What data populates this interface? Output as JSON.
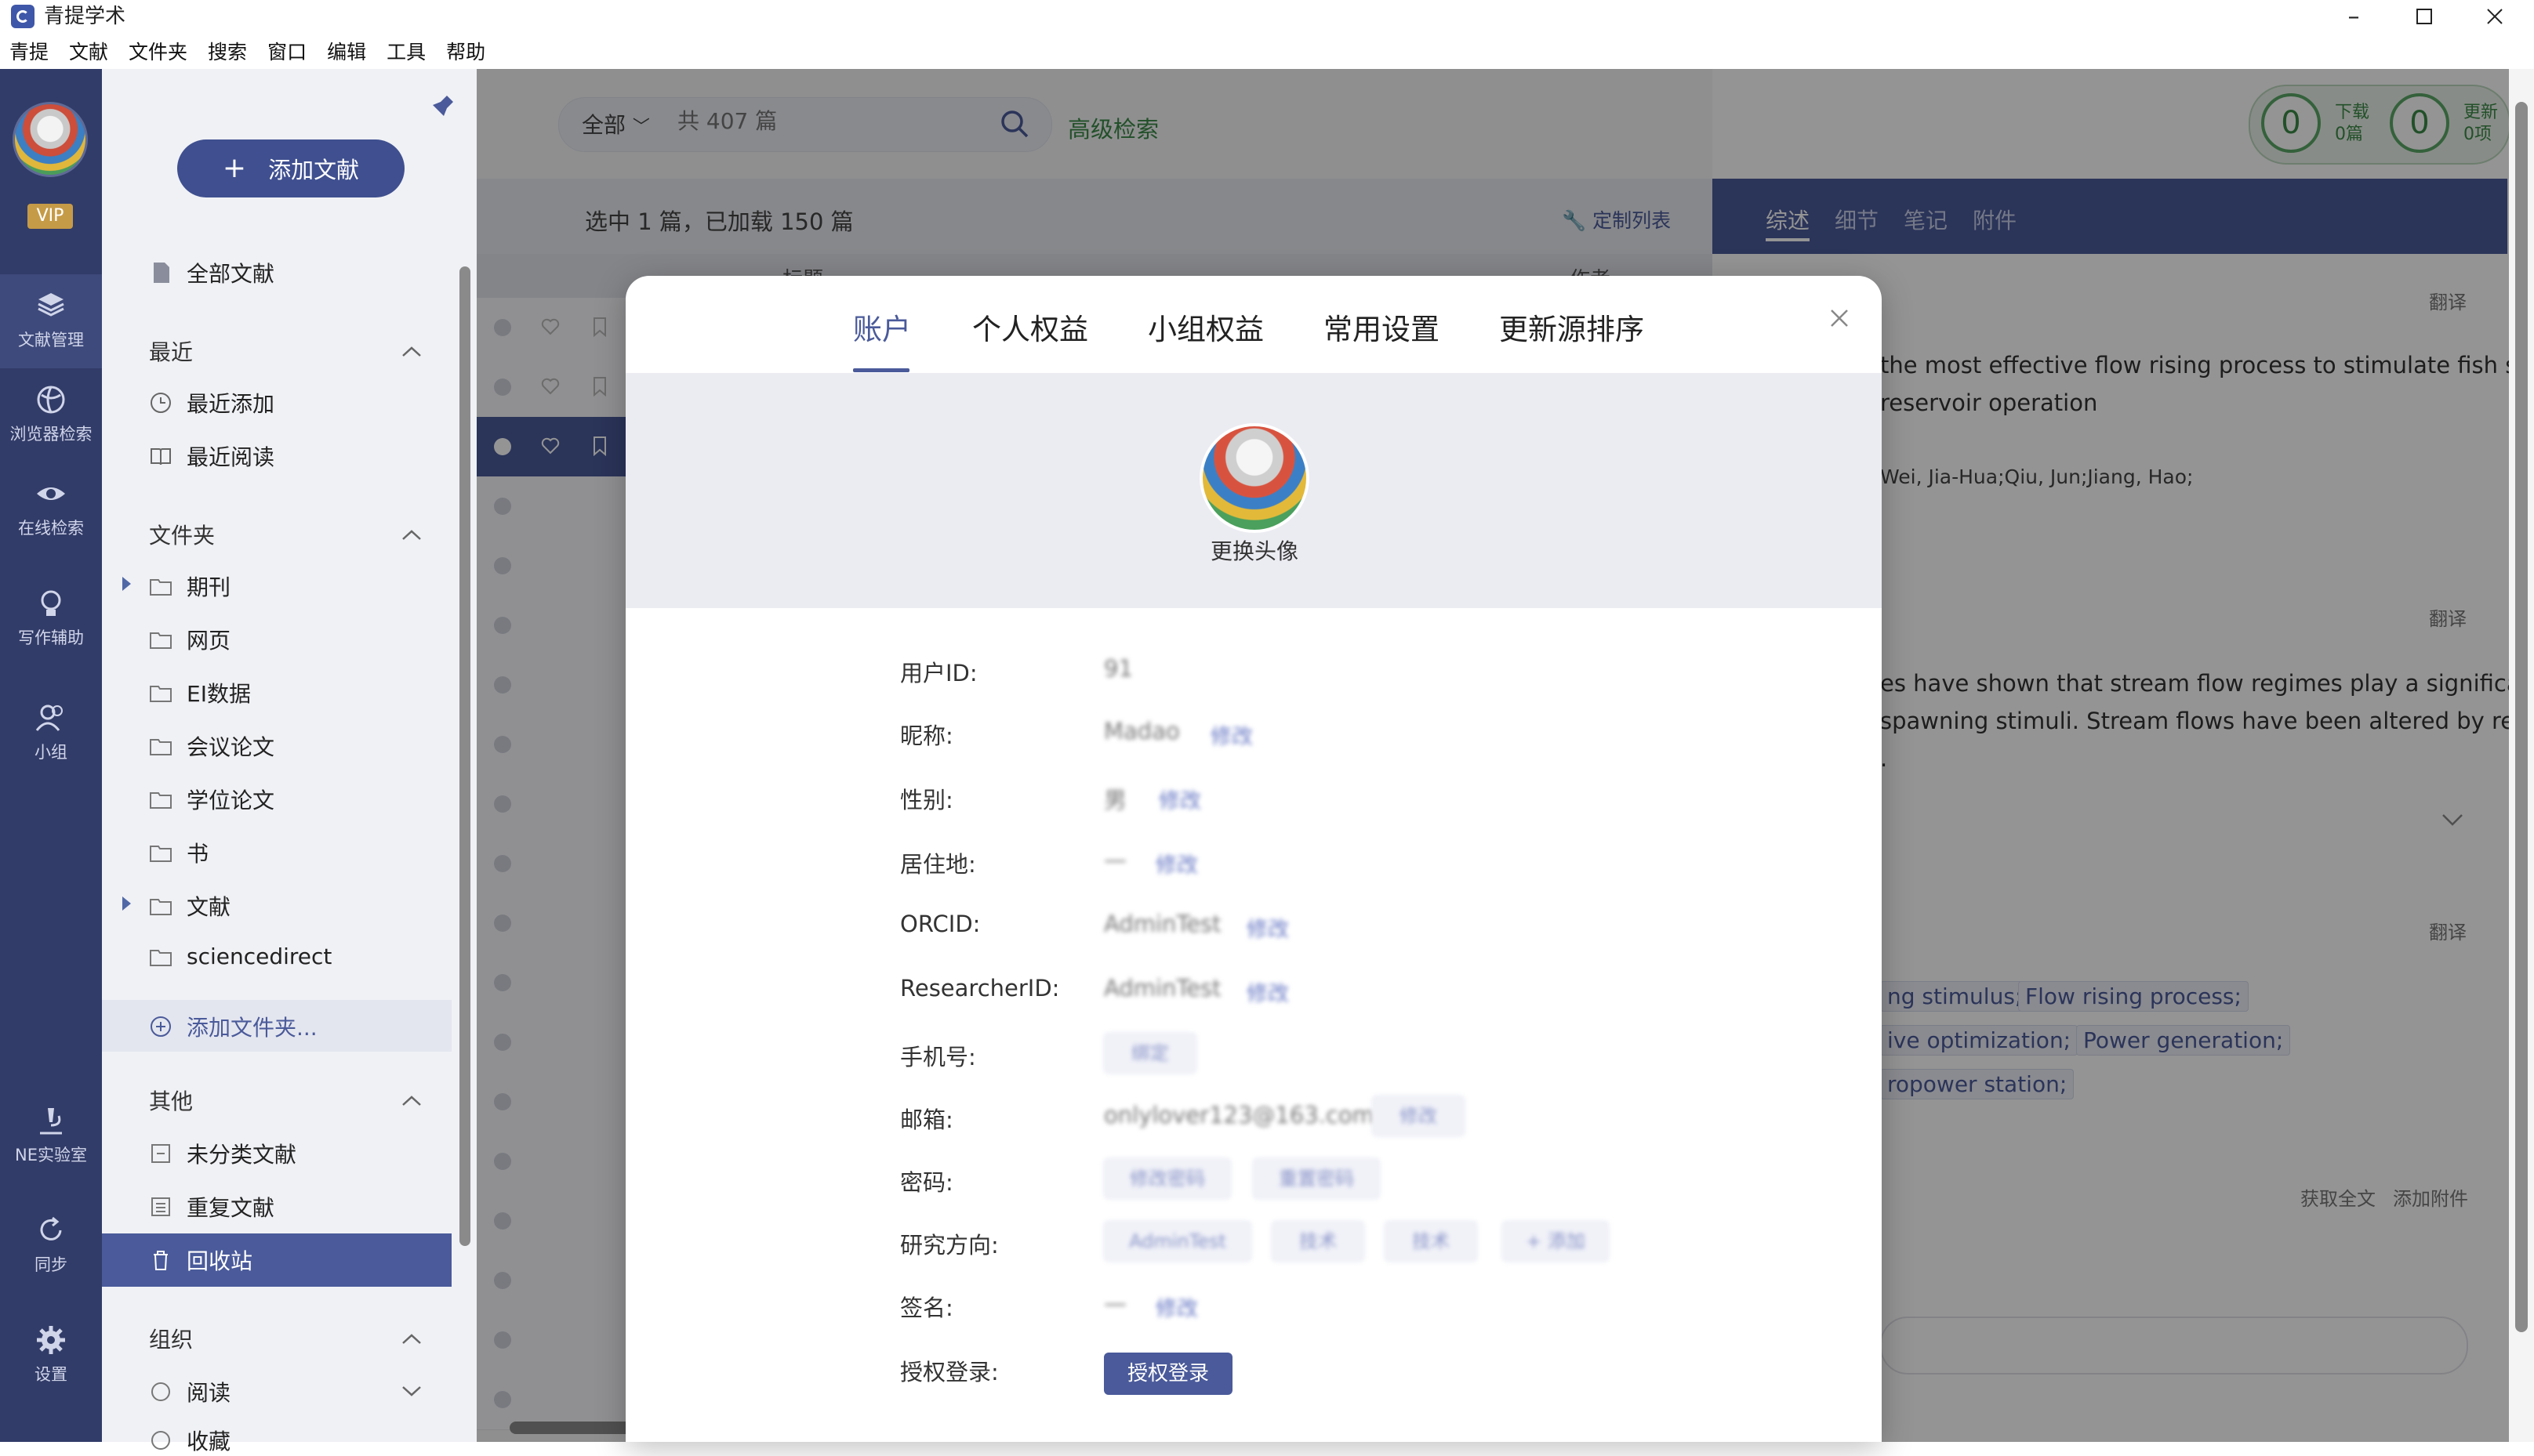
{
  "window": {
    "title": "青提学术"
  },
  "menu": [
    "青提",
    "文献",
    "文件夹",
    "搜索",
    "窗口",
    "编辑",
    "工具",
    "帮助"
  ],
  "rail": {
    "vip": "VIP",
    "items": [
      {
        "label": "文献管理",
        "icon": "document-stack-icon"
      },
      {
        "label": "浏览器检索",
        "icon": "browser-icon"
      },
      {
        "label": "在线检索",
        "icon": "eye-icon"
      },
      {
        "label": "写作辅助",
        "icon": "lightbulb-icon"
      },
      {
        "label": "小组",
        "icon": "group-icon"
      },
      {
        "label": "NE实验室",
        "icon": "microscope-icon"
      },
      {
        "label": "同步",
        "icon": "sync-icon"
      },
      {
        "label": "设置",
        "icon": "gear-icon"
      }
    ]
  },
  "folders": {
    "add_button": "添加文献",
    "all_docs": "全部文献",
    "recent_header": "最近",
    "recent_added": "最近添加",
    "recent_read": "最近阅读",
    "folder_header": "文件夹",
    "folder_items": [
      "期刊",
      "网页",
      "EI数据",
      "会议论文",
      "学位论文",
      "书",
      "文献",
      "sciencedirect"
    ],
    "add_folder": "添加文件夹...",
    "other_header": "其他",
    "uncategorized": "未分类文献",
    "duplicates": "重复文献",
    "recycle": "回收站",
    "org_header": "组织",
    "read": "阅读",
    "favorite": "收藏"
  },
  "search": {
    "scope": "全部",
    "placeholder": "共 407 篇",
    "advanced": "高级检索"
  },
  "stats": {
    "download_count": "0",
    "download_label": "下载",
    "download_sub": "0篇",
    "update_count": "0",
    "update_label": "更新",
    "update_sub": "0项"
  },
  "list": {
    "selected_text": "选中 1 篇，已加载 150 篇",
    "custom_list": "定制列表",
    "col_title": "标题",
    "col_author": "作者"
  },
  "detail": {
    "tabs": [
      "综述",
      "细节",
      "笔记",
      "附件"
    ],
    "translate": "翻译",
    "title_line1": "the most effective flow rising process to stimulate fish s",
    "title_line2": "reservoir operation",
    "authors": "Wei, Jia-Hua;Qiu, Jun;Jiang, Hao;",
    "abstract_line1": "es have shown that stream flow regimes play a significa",
    "abstract_line2": "spawning stimuli. Stream flows have been altered by re",
    "abstract_line3": ".",
    "keywords": [
      "ng stimulus;",
      "Flow rising process;",
      "ive optimization;",
      "Power generation;",
      "ropower station;"
    ],
    "get_fulltext": "获取全文",
    "add_attachment": "添加附件"
  },
  "modal": {
    "tabs": [
      "账户",
      "个人权益",
      "小组权益",
      "常用设置",
      "更新源排序"
    ],
    "change_avatar": "更换头像",
    "fields": {
      "user_id": {
        "label": "用户ID:",
        "value": "91"
      },
      "nickname": {
        "label": "昵称:",
        "value": "Madao",
        "edit": "修改"
      },
      "gender": {
        "label": "性别:",
        "value": "男",
        "edit": "修改"
      },
      "residence": {
        "label": "居住地:",
        "value": "—",
        "edit": "修改"
      },
      "orcid": {
        "label": "ORCID:",
        "value": "AdminTest",
        "edit": "修改"
      },
      "researcher_id": {
        "label": "ResearcherID:",
        "value": "AdminTest",
        "edit": "修改"
      },
      "phone": {
        "label": "手机号:",
        "button": "绑定"
      },
      "email": {
        "label": "邮箱:",
        "value": "onlylover123@163.com",
        "button": "修改"
      },
      "password": {
        "label": "密码:",
        "button1": "修改密码",
        "button2": "重置密码"
      },
      "research": {
        "label": "研究方向:",
        "tags": [
          "AdminTest",
          "技术",
          "技术"
        ],
        "add": "+ 添加"
      },
      "signature": {
        "label": "签名:",
        "value": "—",
        "edit": "修改"
      },
      "auth_login": {
        "label": "授权登录:",
        "button": "授权登录"
      }
    }
  }
}
